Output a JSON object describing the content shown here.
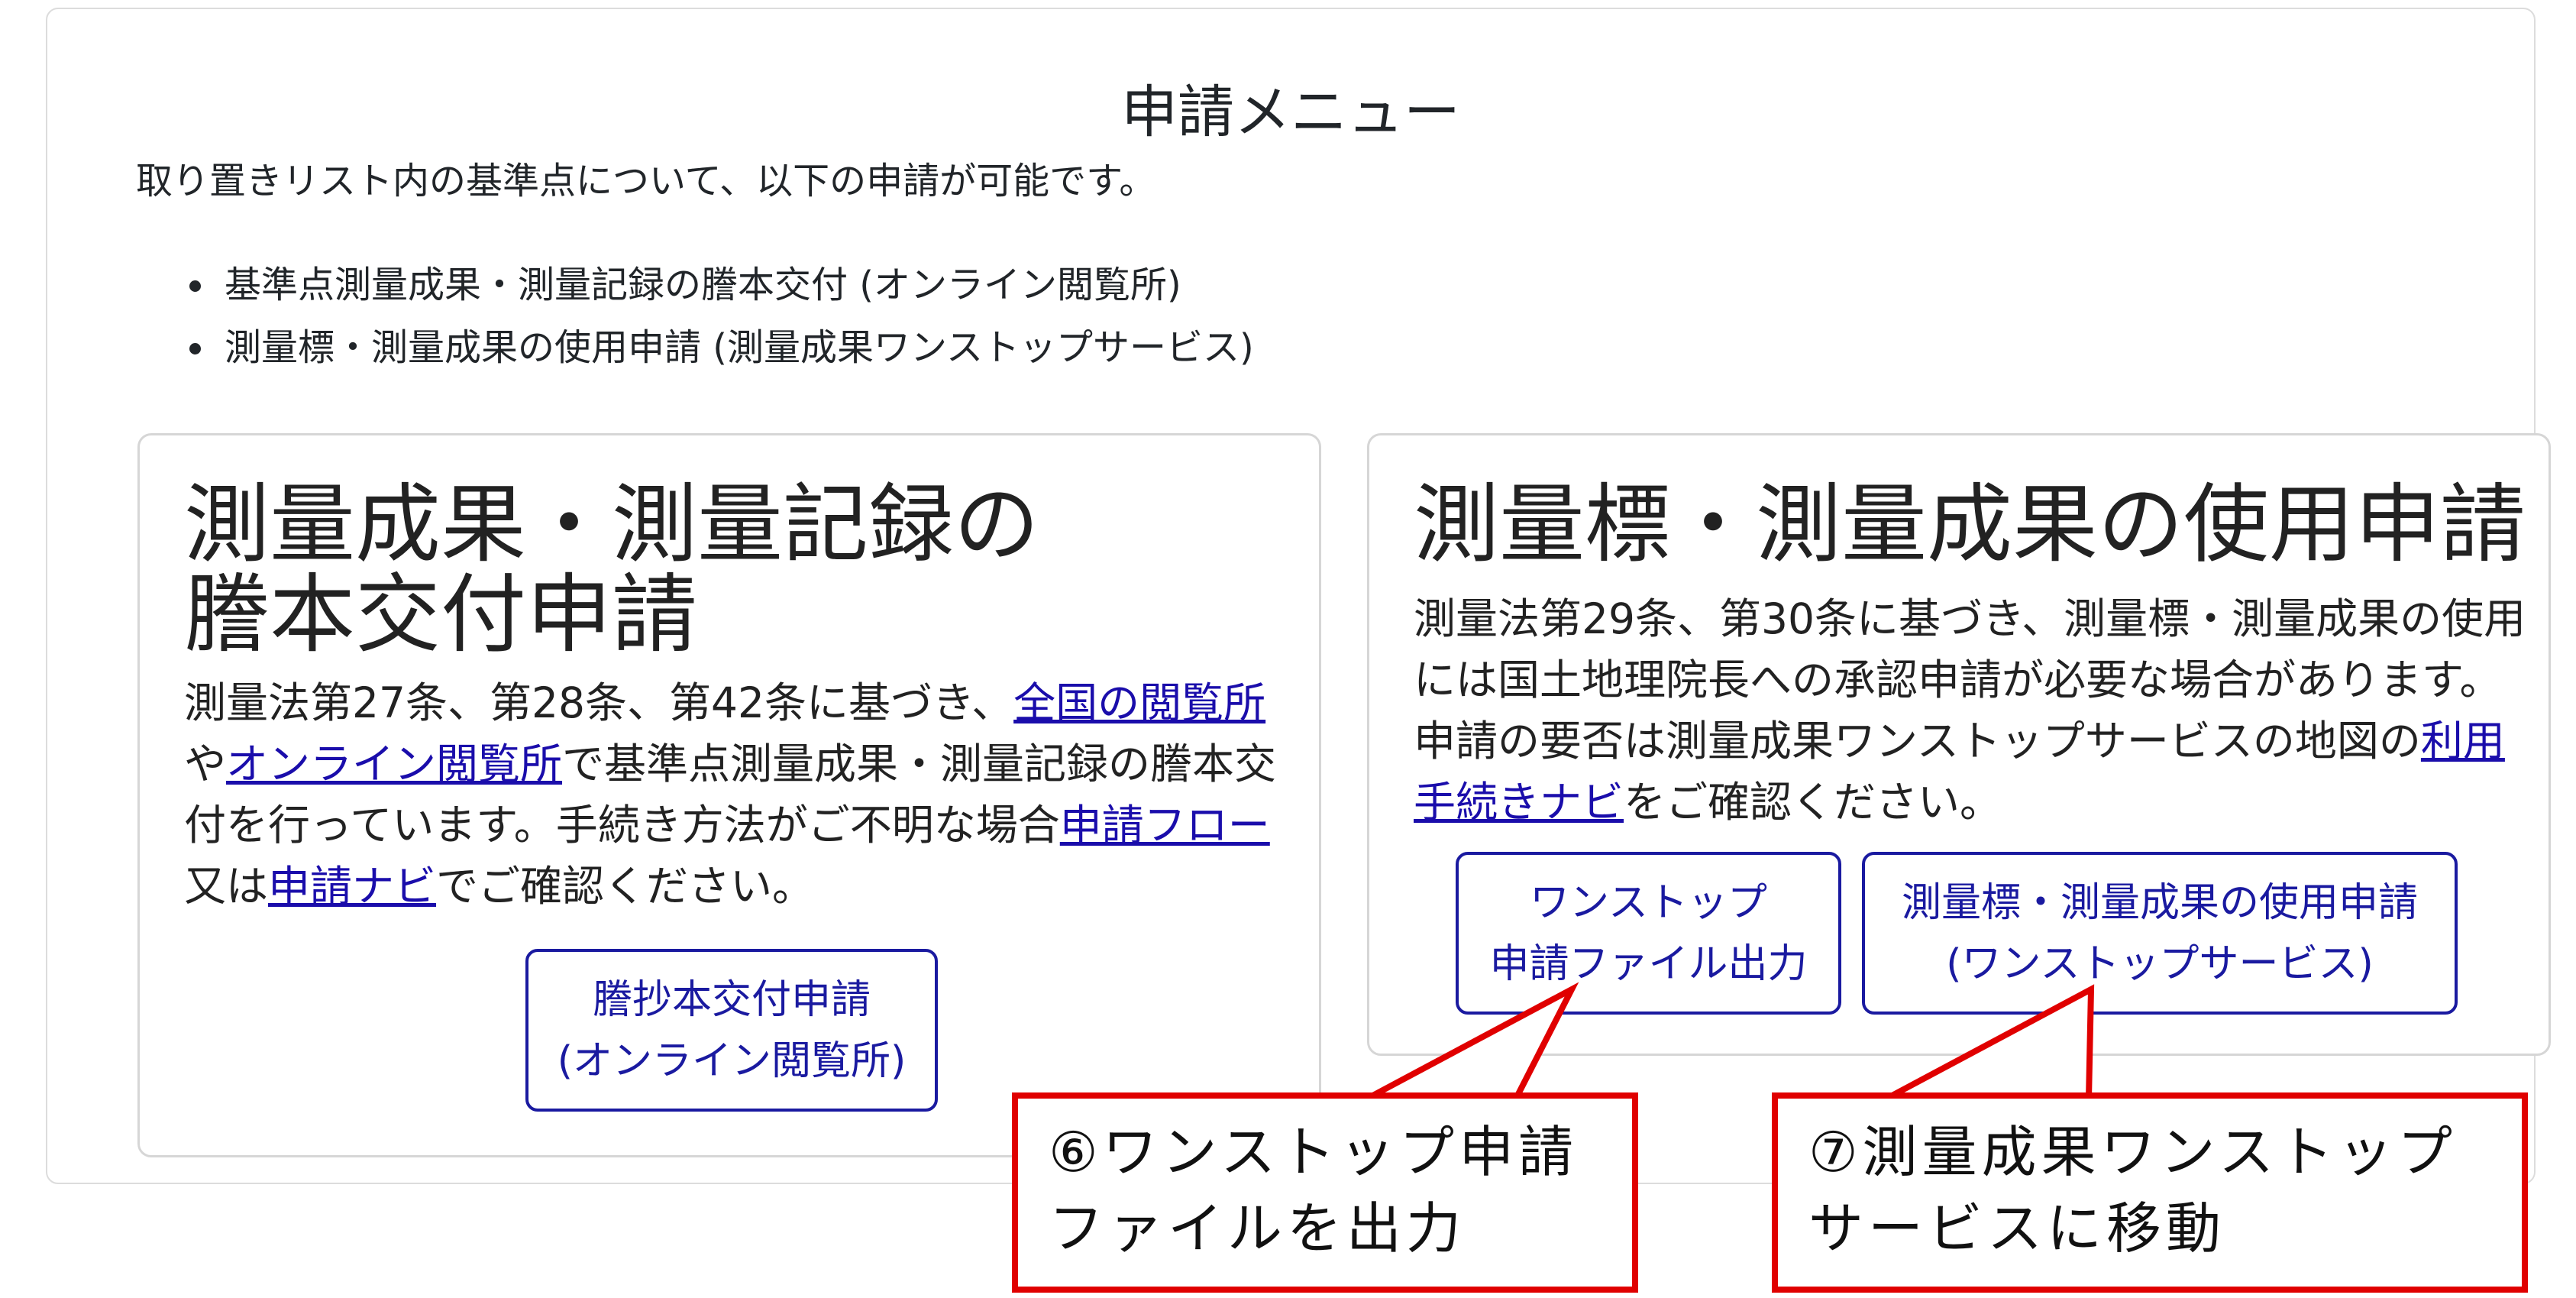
{
  "menu": {
    "title": "申請メニュー",
    "intro": "取り置きリスト内の基準点について、以下の申請が可能です。",
    "options": [
      "基準点測量成果・測量記録の謄本交付 (オンライン閲覧所)",
      "測量標・測量成果の使用申請 (測量成果ワンストップサービス)"
    ]
  },
  "left_card": {
    "title_line1": "測量成果・測量記録の",
    "title_line2": "謄本交付申請",
    "text_1": "測量法第27条、第28条、第42条に基づき、",
    "link_national": "全国の閲覧所",
    "text_2": "や",
    "link_online": "オンライン閲覧所",
    "text_3": "で基準点測量成果・測量記録の謄本交付を行っています。手続き方法がご不明な場合",
    "link_flow": "申請フロー",
    "text_4": "又は",
    "link_navi": "申請ナビ",
    "text_5": "でご確認ください。",
    "button_line1": "謄抄本交付申請",
    "button_line2": "(オンライン閲覧所)"
  },
  "right_card": {
    "title": "測量標・測量成果の使用申請",
    "text_1": "測量法第29条、第30条に基づき、測量標・測量成果の使用には国土地理院長への承認申請が必要な場合があります。申請の要否は測量成果ワンストップサービスの地図の",
    "link_navi": "利用手続きナビ",
    "text_2": "をご確認ください。",
    "button_file_line1": "ワンストップ",
    "button_file_line2": "申請ファイル出力",
    "button_apply_line1": "測量標・測量成果の使用申請",
    "button_apply_line2": "(ワンストップサービス)"
  },
  "callouts": {
    "c6_line1": "⑥ワンストップ申請",
    "c6_line2": "ファイルを出力",
    "c7_line1": "⑦測量成果ワンストップ",
    "c7_line2": "サービスに移動"
  },
  "colors": {
    "link": "#1a0dab",
    "button": "#1a1aa0",
    "callout_border": "#e00000"
  }
}
